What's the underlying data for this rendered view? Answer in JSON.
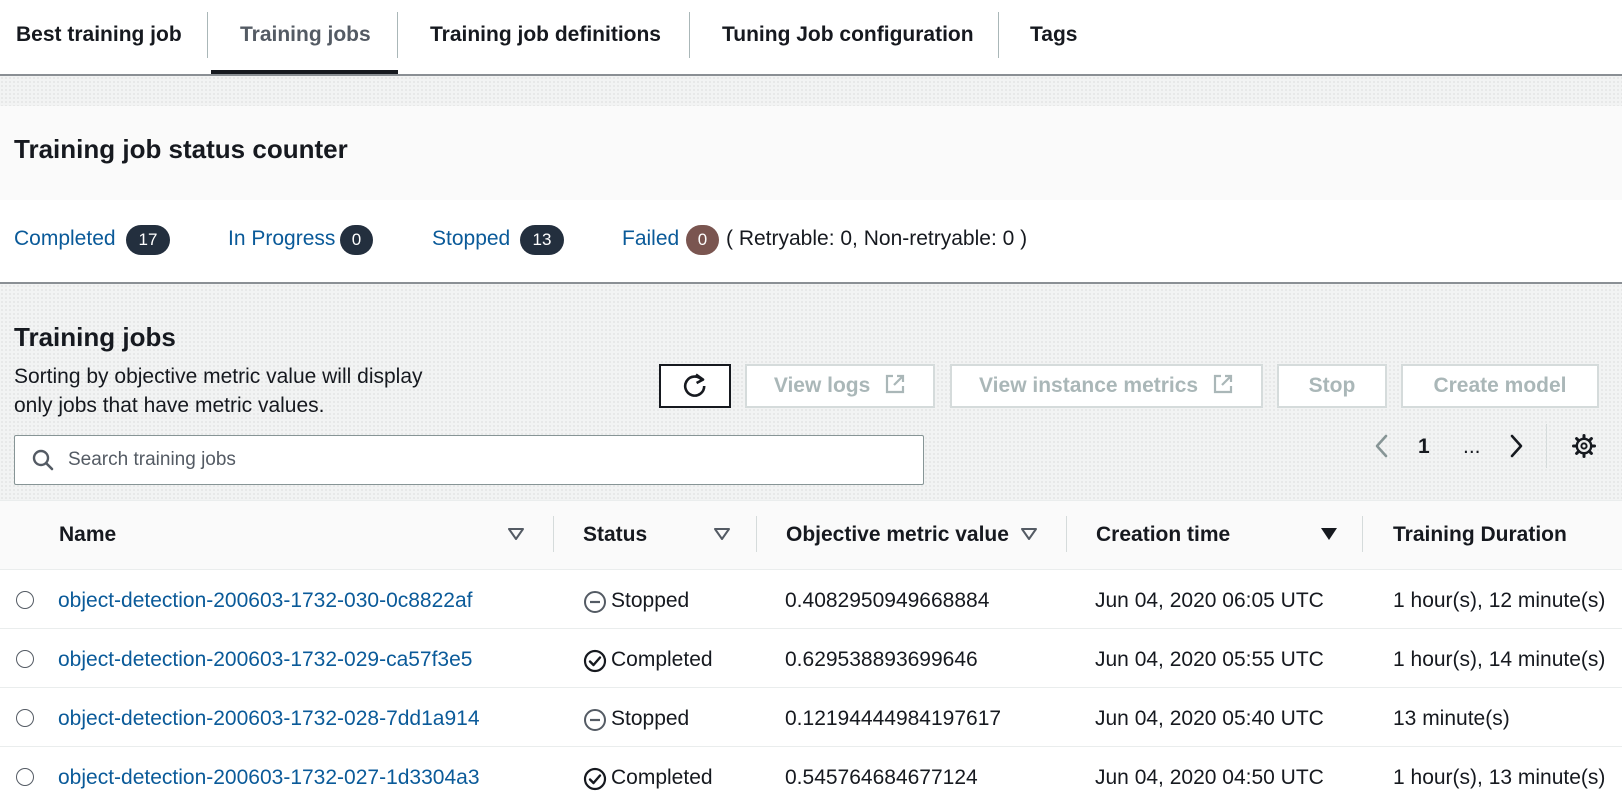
{
  "tabs": [
    {
      "label": "Best training job"
    },
    {
      "label": "Training jobs"
    },
    {
      "label": "Training job definitions"
    },
    {
      "label": "Tuning Job configuration"
    },
    {
      "label": "Tags"
    }
  ],
  "counter": {
    "title": "Training job status counter",
    "completed": {
      "label": "Completed",
      "count": "17"
    },
    "in_progress": {
      "label": "In Progress",
      "count": "0"
    },
    "stopped": {
      "label": "Stopped",
      "count": "13"
    },
    "failed": {
      "label": "Failed",
      "count": "0"
    },
    "retry_text": "( Retryable: 0, Non-retryable: 0 )"
  },
  "jobs": {
    "title": "Training jobs",
    "description_line1": "Sorting by objective metric value will display",
    "description_line2": "only jobs that have metric values.",
    "buttons": {
      "view_logs": "View logs",
      "view_instance_metrics": "View instance metrics",
      "stop": "Stop",
      "create_model": "Create model"
    },
    "search_placeholder": "Search training jobs",
    "pager": {
      "current_page": "1",
      "ellipsis": "..."
    }
  },
  "table": {
    "headers": {
      "name": "Name",
      "status": "Status",
      "objective": "Objective metric value",
      "creation": "Creation time",
      "duration": "Training Duration"
    },
    "rows": [
      {
        "name": "object-detection-200603-1732-030-0c8822af",
        "status": "Stopped",
        "objective": "0.4082950949668884",
        "creation": "Jun 04, 2020 06:05 UTC",
        "duration": "1 hour(s), 12 minute(s)"
      },
      {
        "name": "object-detection-200603-1732-029-ca57f3e5",
        "status": "Completed",
        "objective": "0.629538893699646",
        "creation": "Jun 04, 2020 05:55 UTC",
        "duration": "1 hour(s), 14 minute(s)"
      },
      {
        "name": "object-detection-200603-1732-028-7dd1a914",
        "status": "Stopped",
        "objective": "0.12194444984197617",
        "creation": "Jun 04, 2020 05:40 UTC",
        "duration": "13 minute(s)"
      },
      {
        "name": "object-detection-200603-1732-027-1d3304a3",
        "status": "Completed",
        "objective": "0.545764684677124",
        "creation": "Jun 04, 2020 04:50 UTC",
        "duration": "1 hour(s), 13 minute(s)"
      }
    ]
  },
  "colors": {
    "link": "#0a5a99",
    "badge_dark": "#232f3e",
    "badge_failed": "#7a5550"
  }
}
